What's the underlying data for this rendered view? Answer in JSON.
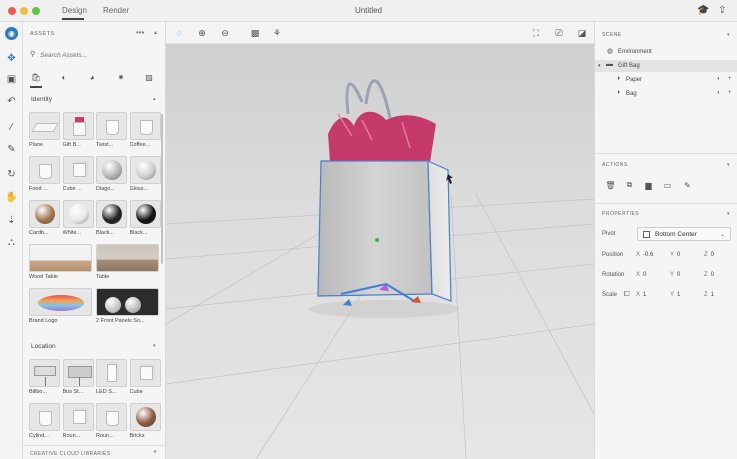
{
  "window": {
    "title": "Untitled",
    "tabs": [
      {
        "label": "Design",
        "active": true
      },
      {
        "label": "Render",
        "active": false
      }
    ],
    "right_icons": [
      "learn-icon",
      "share-icon"
    ]
  },
  "rail_tools": [
    "app-logo-icon",
    "select-move-icon",
    "frame-icon",
    "undo-icon",
    "magic-wand-icon",
    "eyedropper-icon",
    "orbit-icon",
    "pan-hand-icon",
    "dolly-icon",
    "camera-bookmark-icon"
  ],
  "assets": {
    "header": "ASSETS",
    "search_placeholder": "Search Assets...",
    "categories": [
      "models-icon",
      "materials-icon",
      "lights-icon",
      "environment-icon",
      "images-icon"
    ],
    "sections": [
      {
        "title": "Identity",
        "tiles": [
          {
            "label": "Plane",
            "kind": "plane"
          },
          {
            "label": "Gift B...",
            "kind": "bag"
          },
          {
            "label": "Twist...",
            "kind": "cup"
          },
          {
            "label": "Coffee...",
            "kind": "cup"
          },
          {
            "label": "Food ...",
            "kind": "cup"
          },
          {
            "label": "Cube ...",
            "kind": "box"
          },
          {
            "label": "Diago...",
            "kind": "sphere",
            "color": "#b5b5b5"
          },
          {
            "label": "Gloss...",
            "kind": "sphere",
            "color": "#cfcfcf"
          },
          {
            "label": "Cardb...",
            "kind": "sphere",
            "color": "#a0764e"
          },
          {
            "label": "White...",
            "kind": "sphere",
            "color": "#e8e8e8"
          },
          {
            "label": "Black...",
            "kind": "sphere",
            "color": "#222222"
          },
          {
            "label": "Black...",
            "kind": "sphere",
            "color": "#111111"
          },
          {
            "label": "Wood Table",
            "kind": "wood",
            "wide": true
          },
          {
            "label": "Table",
            "kind": "table",
            "wide": true
          },
          {
            "label": "Brand Logo",
            "kind": "logo",
            "wide": true
          },
          {
            "label": "2 Front Panels So...",
            "kind": "panels",
            "wide": true
          }
        ]
      },
      {
        "title": "Location",
        "tiles": [
          {
            "label": "Billbo...",
            "kind": "billboard"
          },
          {
            "label": "Bus St...",
            "kind": "bus"
          },
          {
            "label": "LED S...",
            "kind": "led"
          },
          {
            "label": "Cube",
            "kind": "box"
          },
          {
            "label": "Cylind...",
            "kind": "cup"
          },
          {
            "label": "Roun...",
            "kind": "box"
          },
          {
            "label": "Roun...",
            "kind": "cup"
          },
          {
            "label": "Bricks",
            "kind": "sphere",
            "color": "#8b5a3c"
          }
        ]
      }
    ],
    "libraries_label": "CREATIVE CLOUD LIBRARIES"
  },
  "viewport_tools_left": [
    "marquee-select-icon",
    "add-point-icon",
    "remove-point-icon",
    "image-place-icon",
    "tree-icon"
  ],
  "viewport_tools_right": [
    "fullscreen-icon",
    "camera-icon",
    "render-preview-icon"
  ],
  "scene": {
    "header": "SCENE",
    "items": [
      {
        "label": "Environment",
        "icon": "globe-icon",
        "indent": 0,
        "selected": false,
        "actions": false
      },
      {
        "label": "Gift Bag",
        "icon": "folder-icon",
        "indent": 0,
        "selected": true,
        "actions": false
      },
      {
        "label": "Paper",
        "icon": "material-icon",
        "indent": 1,
        "selected": false,
        "actions": true
      },
      {
        "label": "Bag",
        "icon": "material-icon",
        "indent": 1,
        "selected": false,
        "actions": true
      }
    ]
  },
  "actions": {
    "header": "ACTIONS",
    "icons": [
      "delete-icon",
      "duplicate-icon",
      "group-icon",
      "ungroup-icon",
      "eyedropper-icon"
    ]
  },
  "properties": {
    "header": "PROPERTIES",
    "pivot_label": "Pivot",
    "pivot_value": "Bottom Center",
    "position": {
      "label": "Position",
      "x": "-0.6",
      "y": "0",
      "z": "0"
    },
    "rotation": {
      "label": "Rotation",
      "x": "0",
      "y": "0",
      "z": "0"
    },
    "scale": {
      "label": "Scale",
      "x": "1",
      "y": "1",
      "z": "1"
    },
    "axis_labels": {
      "x": "X",
      "y": "Y",
      "z": "Z"
    }
  },
  "colors": {
    "accent": "#2c79c7",
    "selection": "#4a7fc9",
    "tissue": "#c4285f",
    "bag": "#c9c9c9"
  }
}
